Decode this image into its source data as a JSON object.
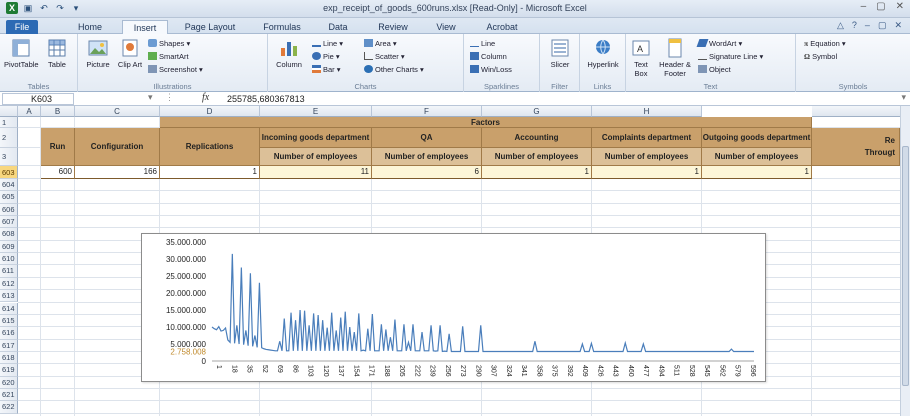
{
  "window": {
    "title": "exp_receipt_of_goods_600runs.xlsx [Read-Only] - Microsoft Excel"
  },
  "tabs": [
    "File",
    "Home",
    "Insert",
    "Page Layout",
    "Formulas",
    "Data",
    "Review",
    "View",
    "Acrobat"
  ],
  "active_tab": "Insert",
  "ribbon": {
    "tables": {
      "label": "Tables",
      "pivot": "PivotTable",
      "table": "Table"
    },
    "illustrations": {
      "label": "Illustrations",
      "picture": "Picture",
      "clipart": "Clip Art",
      "shapes": "Shapes",
      "smartart": "SmartArt",
      "screenshot": "Screenshot"
    },
    "charts": {
      "label": "Charts",
      "column": "Column",
      "line": "Line",
      "pie": "Pie",
      "bar": "Bar",
      "area": "Area",
      "scatter": "Scatter",
      "other": "Other Charts"
    },
    "sparklines": {
      "label": "Sparklines",
      "line": "Line",
      "column": "Column",
      "winloss": "Win/Loss"
    },
    "filter": {
      "label": "Filter",
      "slicer": "Slicer"
    },
    "links": {
      "label": "Links",
      "hyperlink": "Hyperlink"
    },
    "text": {
      "label": "Text",
      "textbox": "Text Box",
      "header": "Header & Footer",
      "wordart": "WordArt",
      "signature": "Signature Line",
      "object": "Object"
    },
    "symbols": {
      "label": "Symbols",
      "equation": "Equation",
      "symbol": "Symbol"
    }
  },
  "formula_bar": {
    "name_box": "K603",
    "fx": "fx",
    "formula": "255785,680367813"
  },
  "columns": [
    "A",
    "B",
    "C",
    "D",
    "E",
    "F",
    "G",
    "H"
  ],
  "rows": [
    "1",
    "2",
    "3",
    "603",
    "604",
    "605",
    "606",
    "607",
    "608",
    "609",
    "610",
    "611",
    "612",
    "613",
    "614",
    "615",
    "616",
    "617",
    "618",
    "619",
    "620",
    "621",
    "622"
  ],
  "selected_row": "603",
  "table": {
    "factors": "Factors",
    "run": "Run",
    "configuration": "Configuration",
    "replications": "Replications",
    "incoming": "Incoming goods department",
    "qa": "QA",
    "accounting": "Accounting",
    "complaints": "Complaints department",
    "outgoing": "Outgoing goods department",
    "re": "Re",
    "throughput": "Througt",
    "num_emp": "Number of employees",
    "row603": [
      "600",
      "166",
      "1",
      "11",
      "6",
      "1",
      "1",
      "1"
    ]
  },
  "chart_data": {
    "type": "line",
    "ylim": [
      0,
      35000000
    ],
    "yticks": [
      "35.000.000",
      "30.000.000",
      "25.000.000",
      "20.000.000",
      "15.000.000",
      "10.000.000",
      "5.000.000",
      "0"
    ],
    "annotation": "2.758.008",
    "x_ticks": [
      "1",
      "18",
      "35",
      "52",
      "69",
      "86",
      "103",
      "120",
      "137",
      "154",
      "171",
      "188",
      "205",
      "222",
      "239",
      "256",
      "273",
      "290",
      "307",
      "324",
      "341",
      "358",
      "375",
      "392",
      "409",
      "426",
      "443",
      "460",
      "477",
      "494",
      "511",
      "528",
      "545",
      "562",
      "579",
      "596"
    ],
    "series": [
      {
        "color": "#4a7ebb",
        "values": [
          10000000,
          9500000,
          9200000,
          10100000,
          8800000,
          9000000,
          9700000,
          6200000,
          5500000,
          31500000,
          5200000,
          10500000,
          5000000,
          27500000,
          4800000,
          9000000,
          4500000,
          25800000,
          4300000,
          7500000,
          4000000,
          23000000,
          3900000,
          3600000,
          3400000,
          3300000,
          3200000,
          3100000,
          3000000,
          3000000,
          5800000,
          3000000,
          12500000,
          3000000,
          3000000,
          14200000,
          3000000,
          12000000,
          3000000,
          15000000,
          3000000,
          14800000,
          3000000,
          10500000,
          3000000,
          14000000,
          3000000,
          13500000,
          3000000,
          12000000,
          3000000,
          9800000,
          3000000,
          14200000,
          3000000,
          9000000,
          3000000,
          12800000,
          3000000,
          14500000,
          3000000,
          10000000,
          3000000,
          8500000,
          3000000,
          14000000,
          3000000,
          3200000,
          3000000,
          9500000,
          3000000,
          13800000,
          3000000,
          3000000,
          3000000,
          10800000,
          3000000,
          9300000,
          3000000,
          7000000,
          3000000,
          12200000,
          3000000,
          3000000,
          3000000,
          10800000,
          3000000,
          5500000,
          3000000,
          10800000,
          3000000,
          3000000,
          3000000,
          8500000,
          3000000,
          3000000,
          3000000,
          10500000,
          3000000,
          2900000,
          3000000,
          10500000,
          2800000,
          2900000,
          2800000,
          8000000,
          2800000,
          2800000,
          2800000,
          2800000,
          2800000,
          10200000,
          2800000,
          2800000,
          2800000,
          2800000,
          2800000,
          2800000,
          2800000,
          10500000,
          2800000,
          2800000,
          2800000,
          2800000,
          2800000,
          2800000,
          2800000,
          2800000,
          2800000,
          2800000,
          2800000,
          2800000,
          2800000,
          2800000,
          2800000,
          2800000,
          2800000,
          2800000,
          2800000,
          2800000,
          2800000,
          2800000,
          2800000,
          5800000,
          2800000,
          2800000,
          2800000,
          2800000,
          2800000,
          2800000,
          2800000,
          2800000,
          2800000,
          2800000,
          2800000,
          2800000,
          2800000,
          2800000,
          2800000,
          2800000,
          2800000,
          2800000,
          2800000,
          2800000,
          5000000,
          2800000,
          2800000,
          2800000,
          5200000,
          2800000,
          2800000,
          2800000,
          2800000,
          2800000,
          2800000,
          2800000,
          2800000,
          2800000,
          2800000,
          2800000,
          2800000,
          2800000,
          2800000,
          5300000,
          2800000,
          2800000,
          2800000,
          2800000,
          2800000,
          2800000,
          2800000,
          5000000,
          2800000,
          2800000,
          2800000,
          2800000,
          2800000,
          2800000,
          2800000,
          2800000,
          2800000,
          2800000,
          2800000,
          2800000,
          2800000,
          2800000,
          2800000,
          2800000,
          2800000,
          2800000,
          2800000,
          2800000,
          2800000,
          2800000,
          2800000,
          2800000,
          2800000,
          2800000,
          2800000,
          2800000,
          2800000,
          2800000,
          2800000,
          2800000,
          2800000,
          2800000,
          2800000,
          2800000,
          2800000,
          2800000,
          3500000,
          2800000,
          2800000,
          2800000,
          2800000,
          2800000,
          2800000,
          2800000,
          2800000,
          2800000,
          2800000
        ]
      }
    ]
  }
}
